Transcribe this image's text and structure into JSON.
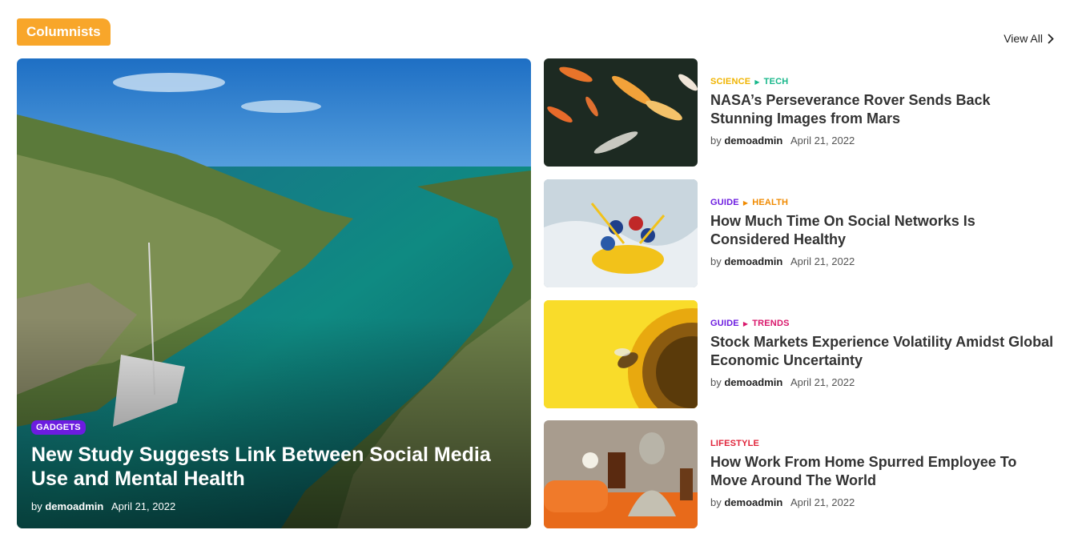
{
  "section": {
    "title": "Columnists",
    "view_all": "View All"
  },
  "featured": {
    "category": "GADGETS",
    "title": "New Study Suggests Link Between Social Media Use and Mental Health",
    "by": "by",
    "author": "demoadmin",
    "date": "April 21, 2022",
    "badge_color": "#6c1ce0"
  },
  "articles": [
    {
      "cat1": "SCIENCE",
      "cat1_color": "#f0b400",
      "cat2": "TECH",
      "cat2_color": "#17b78a",
      "title": "NASA’s Perseverance Rover Sends Back Stunning Images from Mars",
      "by": "by",
      "author": "demoadmin",
      "date": "April 21, 2022"
    },
    {
      "cat1": "GUIDE",
      "cat1_color": "#6c1ce0",
      "cat2": "HEALTH",
      "cat2_color": "#f08a00",
      "title": "How Much Time On Social Networks Is Considered Healthy",
      "by": "by",
      "author": "demoadmin",
      "date": "April 21, 2022"
    },
    {
      "cat1": "GUIDE",
      "cat1_color": "#6c1ce0",
      "cat2": "TRENDS",
      "cat2_color": "#d9176b",
      "title": "Stock Markets Experience Volatility Amidst Global Economic Uncertainty",
      "by": "by",
      "author": "demoadmin",
      "date": "April 21, 2022"
    },
    {
      "cat1": "LIFESTYLE",
      "cat1_color": "#e0243a",
      "title": "How Work From Home Spurred Employee To Move Around The World",
      "by": "by",
      "author": "demoadmin",
      "date": "April 21, 2022"
    }
  ],
  "colors": {
    "section_tag": "#f8a62a"
  },
  "icons": {
    "view_all": "chevron-right-icon",
    "category_separator": "triangle-right-icon"
  }
}
